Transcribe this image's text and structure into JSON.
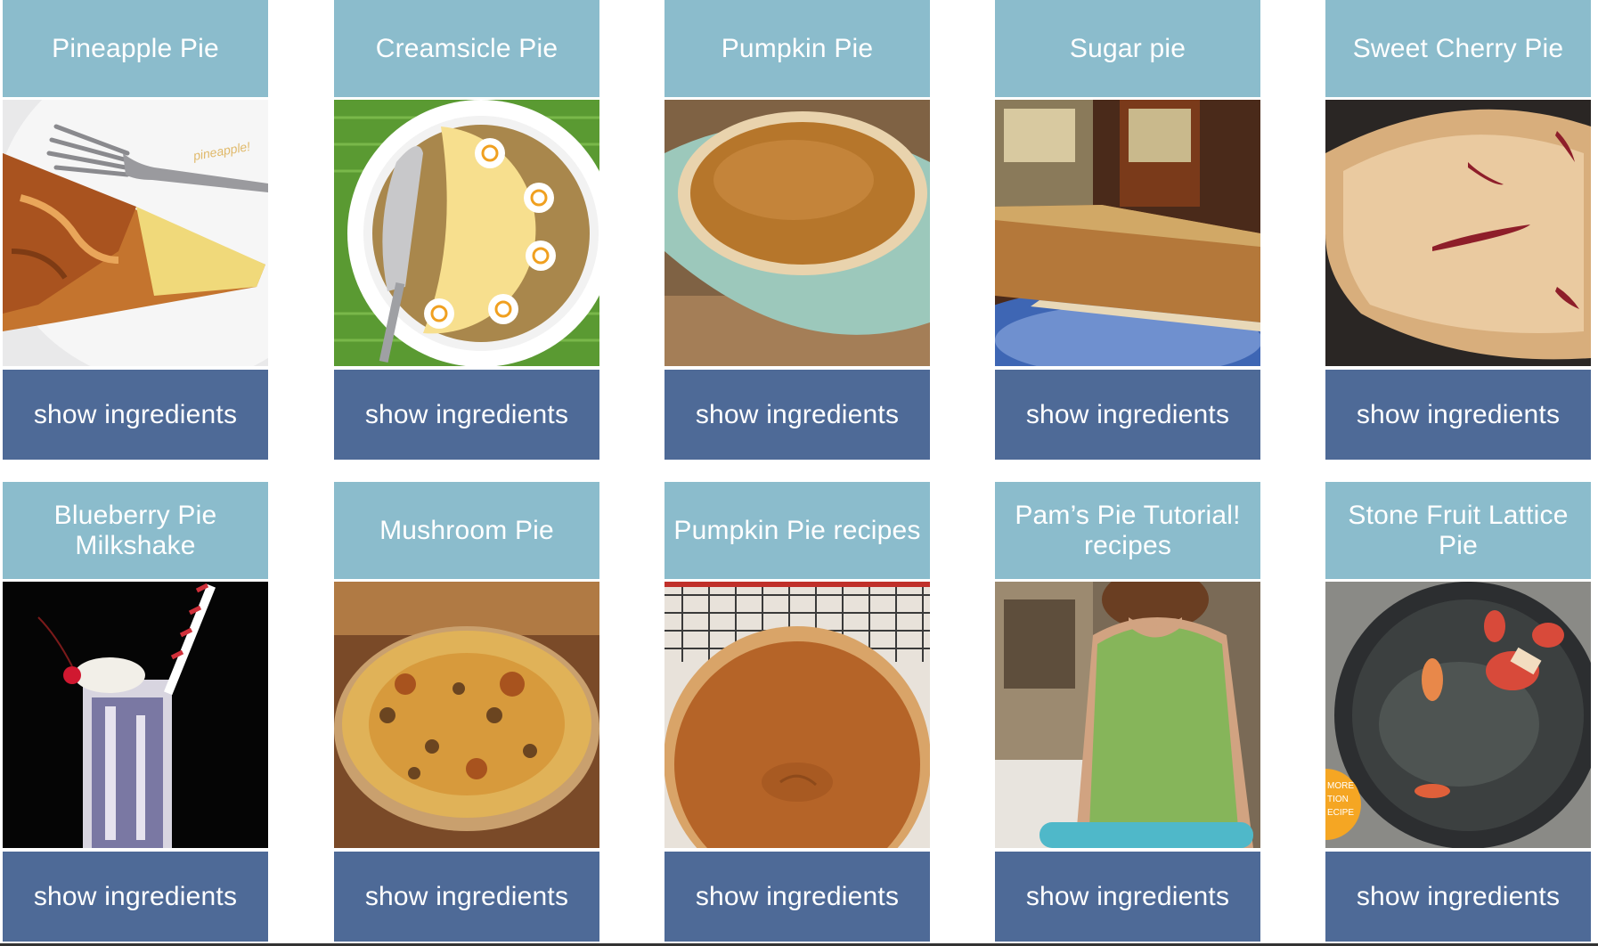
{
  "button_label": "show ingredients",
  "cards": [
    {
      "title": "Pineapple Pie",
      "image": "pineapple-pie-slice",
      "photo_text": "pineapple!"
    },
    {
      "title": "Creamsicle Pie",
      "image": "creamsicle-pie"
    },
    {
      "title": "Pumpkin Pie",
      "image": "pumpkin-pie"
    },
    {
      "title": "Sugar pie",
      "image": "sugar-pie-slice"
    },
    {
      "title": "Sweet Cherry Pie",
      "image": "sweet-cherry-pie"
    },
    {
      "title": "Blueberry Pie Milkshake",
      "image": "blueberry-pie-milkshake"
    },
    {
      "title": "Mushroom Pie",
      "image": "mushroom-pie"
    },
    {
      "title": "Pumpkin Pie recipes",
      "image": "pumpkin-pie-top"
    },
    {
      "title": "Pam’s Pie Tutorial! recipes",
      "image": "pam-pie-tutorial"
    },
    {
      "title": "Stone Fruit Lattice Pie",
      "image": "stone-fruit-lattice-pie",
      "photo_text": [
        "MORE",
        "TION",
        "ECIPE"
      ]
    }
  ],
  "colors": {
    "title_bg": "#8bbccc",
    "button_bg": "#4e6a97",
    "text": "#ffffff"
  }
}
